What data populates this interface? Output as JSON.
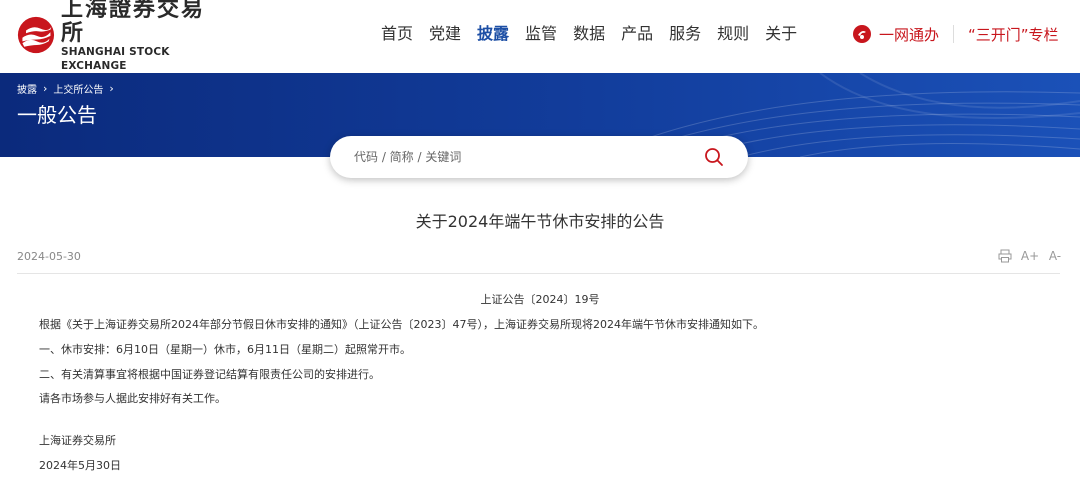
{
  "header": {
    "logo": {
      "cn": "上海證券交易所",
      "en": "SHANGHAI STOCK EXCHANGE"
    },
    "nav": [
      {
        "label": "首页",
        "active": false
      },
      {
        "label": "党建",
        "active": false
      },
      {
        "label": "披露",
        "active": true
      },
      {
        "label": "监管",
        "active": false
      },
      {
        "label": "数据",
        "active": false
      },
      {
        "label": "产品",
        "active": false
      },
      {
        "label": "服务",
        "active": false
      },
      {
        "label": "规则",
        "active": false
      },
      {
        "label": "关于",
        "active": false
      }
    ],
    "quick_links": {
      "onestop": "一网通办",
      "sankaimen": "“三开门”专栏"
    }
  },
  "banner": {
    "breadcrumb": [
      "披露",
      "上交所公告"
    ],
    "title": "一般公告"
  },
  "search": {
    "placeholder": "代码 / 简称 / 关键词"
  },
  "article": {
    "title": "关于2024年端午节休市安排的公告",
    "date": "2024-05-30",
    "doc_no": "上证公告〔2024〕19号",
    "paragraphs": [
      "根据《关于上海证券交易所2024年部分节假日休市安排的通知》（上证公告〔2023〕47号），上海证券交易所现将2024年端午节休市安排通知如下。",
      "一、休市安排：6月10日（星期一）休市，6月11日（星期二）起照常开市。",
      "二、有关清算事宜将根据中国证券登记结算有限责任公司的安排进行。",
      "请各市场参与人据此安排好有关工作。"
    ],
    "signature": "上海证券交易所",
    "sign_date": "2024年5月30日"
  },
  "tools": {
    "font_increase": "A+",
    "font_decrease": "A-"
  },
  "colors": {
    "brand_red": "#c8161d",
    "nav_active": "#1d4fa5",
    "banner_blue": "#123d9c"
  }
}
